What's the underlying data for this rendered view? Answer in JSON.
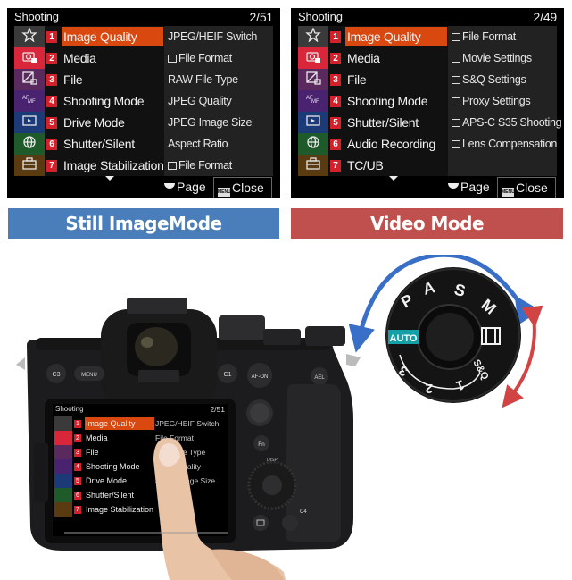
{
  "still_screen": {
    "title": "Shooting",
    "page": "2/51",
    "tabs": [
      {
        "icon": "star-icon",
        "color": "#3a3a3a"
      },
      {
        "icon": "camera-icon",
        "color": "#d9263a"
      },
      {
        "icon": "exposure-icon",
        "color": "#5a2a5e"
      },
      {
        "icon": "focus-mf-icon",
        "color": "#4a2370"
      },
      {
        "icon": "playback-icon",
        "color": "#1d3a78"
      },
      {
        "icon": "network-icon",
        "color": "#1e5a2a"
      },
      {
        "icon": "toolbox-icon",
        "color": "#5a3a10"
      }
    ],
    "items": [
      {
        "num": "1",
        "label": "Image Quality",
        "selected": true
      },
      {
        "num": "2",
        "label": "Media"
      },
      {
        "num": "3",
        "label": "File"
      },
      {
        "num": "4",
        "label": "Shooting Mode"
      },
      {
        "num": "5",
        "label": "Drive Mode"
      },
      {
        "num": "6",
        "label": "Shutter/Silent"
      },
      {
        "num": "7",
        "label": "Image Stabilization"
      }
    ],
    "sub_items": [
      {
        "label": "JPEG/HEIF Switch",
        "icon": ""
      },
      {
        "label": "File Format",
        "icon": "still-icon"
      },
      {
        "label": "RAW File Type",
        "icon": ""
      },
      {
        "label": "JPEG Quality",
        "icon": ""
      },
      {
        "label": "JPEG Image Size",
        "icon": ""
      },
      {
        "label": "Aspect Ratio",
        "icon": ""
      },
      {
        "label": "File Format",
        "icon": "movie-icon"
      }
    ],
    "footer": {
      "page_label": "Page",
      "menu_key": "MENU",
      "close_label": "Close"
    }
  },
  "video_screen": {
    "title": "Shooting",
    "page": "2/49",
    "tabs": [
      {
        "icon": "star-icon",
        "color": "#3a3a3a"
      },
      {
        "icon": "camera-icon",
        "color": "#d9263a"
      },
      {
        "icon": "exposure-icon",
        "color": "#5a2a5e"
      },
      {
        "icon": "focus-mf-icon",
        "color": "#4a2370"
      },
      {
        "icon": "playback-icon",
        "color": "#1d3a78"
      },
      {
        "icon": "network-icon",
        "color": "#1e5a2a"
      },
      {
        "icon": "toolbox-icon",
        "color": "#5a3a10"
      }
    ],
    "items": [
      {
        "num": "1",
        "label": "Image Quality",
        "selected": true
      },
      {
        "num": "2",
        "label": "Media"
      },
      {
        "num": "3",
        "label": "File"
      },
      {
        "num": "4",
        "label": "Shooting Mode"
      },
      {
        "num": "5",
        "label": "Shutter/Silent"
      },
      {
        "num": "6",
        "label": "Audio Recording"
      },
      {
        "num": "7",
        "label": "TC/UB"
      }
    ],
    "sub_items": [
      {
        "label": "File Format",
        "icon": "movie-icon"
      },
      {
        "label": "Movie Settings",
        "icon": "movie-icon"
      },
      {
        "label": "S&Q Settings",
        "icon": "sq-icon"
      },
      {
        "label": "Proxy Settings",
        "icon": "proxy-icon"
      },
      {
        "label": "APS-C S35 Shooting",
        "icon": "still-movie-icon"
      },
      {
        "label": "Lens Compensation",
        "icon": "still-movie-icon"
      }
    ],
    "footer": {
      "page_label": "Page",
      "menu_key": "MENU",
      "close_label": "Close"
    }
  },
  "labels": {
    "still": "Still ImageMode",
    "video": "Video Mode"
  },
  "colors": {
    "still_label": "#4a7ebb",
    "video_label": "#c0504d",
    "selected_item": "#d9480f",
    "item_number": "#d4202b",
    "dial_auto": "#14a0a6",
    "arrow_blue": "#3a6fc8",
    "arrow_red": "#d24444"
  },
  "dial": {
    "marks": [
      "AUTO",
      "P",
      "A",
      "S",
      "M",
      "Movie",
      "S&Q",
      "1",
      "2",
      "3"
    ]
  },
  "camera": {
    "buttons": [
      "C3",
      "MENU",
      "C1",
      "AF-ON",
      "AEL",
      "Fn",
      "DISP",
      "C4"
    ],
    "screen": {
      "title": "Shooting",
      "page": "2/51",
      "items": [
        "Image Quality",
        "Media",
        "File",
        "Shooting Mode",
        "Drive Mode",
        "Shutter/Silent",
        "Image Stabilization"
      ],
      "sub_items": [
        "JPEG/HEIF Switch",
        "File Format",
        "RAW File Type",
        "JPEG Quality",
        "JPEG Image Size"
      ]
    }
  }
}
